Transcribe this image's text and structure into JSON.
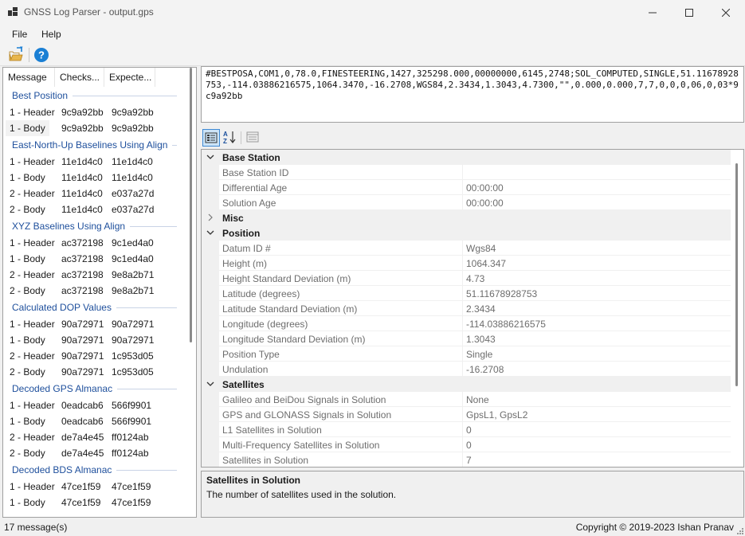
{
  "window": {
    "title": "GNSS Log Parser - output.gps"
  },
  "menu": {
    "file": "File",
    "help": "Help"
  },
  "message_list": {
    "columns": [
      "Message",
      "Checks...",
      "Expecte..."
    ],
    "groups": [
      {
        "name": "Best Position",
        "rows": [
          {
            "msg": "1 - Header",
            "check": "9c9a92bb",
            "expected": "9c9a92bb"
          },
          {
            "msg": "1 - Body",
            "check": "9c9a92bb",
            "expected": "9c9a92bb",
            "selected": true
          }
        ]
      },
      {
        "name": "East-North-Up Baselines Using Align",
        "rows": [
          {
            "msg": "1 - Header",
            "check": "11e1d4c0",
            "expected": "11e1d4c0"
          },
          {
            "msg": "1 - Body",
            "check": "11e1d4c0",
            "expected": "11e1d4c0"
          },
          {
            "msg": "2 - Header",
            "check": "11e1d4c0",
            "expected": "e037a27d"
          },
          {
            "msg": "2 - Body",
            "check": "11e1d4c0",
            "expected": "e037a27d"
          }
        ]
      },
      {
        "name": "XYZ Baselines Using Align",
        "rows": [
          {
            "msg": "1 - Header",
            "check": "ac372198",
            "expected": "9c1ed4a0"
          },
          {
            "msg": "1 - Body",
            "check": "ac372198",
            "expected": "9c1ed4a0"
          },
          {
            "msg": "2 - Header",
            "check": "ac372198",
            "expected": "9e8a2b71"
          },
          {
            "msg": "2 - Body",
            "check": "ac372198",
            "expected": "9e8a2b71"
          }
        ]
      },
      {
        "name": "Calculated DOP Values",
        "rows": [
          {
            "msg": "1 - Header",
            "check": "90a72971",
            "expected": "90a72971"
          },
          {
            "msg": "1 - Body",
            "check": "90a72971",
            "expected": "90a72971"
          },
          {
            "msg": "2 - Header",
            "check": "90a72971",
            "expected": "1c953d05"
          },
          {
            "msg": "2 - Body",
            "check": "90a72971",
            "expected": "1c953d05"
          }
        ]
      },
      {
        "name": "Decoded GPS Almanac",
        "rows": [
          {
            "msg": "1 - Header",
            "check": "0eadcab6",
            "expected": "566f9901"
          },
          {
            "msg": "1 - Body",
            "check": "0eadcab6",
            "expected": "566f9901"
          },
          {
            "msg": "2 - Header",
            "check": "de7a4e45",
            "expected": "ff0124ab"
          },
          {
            "msg": "2 - Body",
            "check": "de7a4e45",
            "expected": "ff0124ab"
          }
        ]
      },
      {
        "name": "Decoded BDS Almanac",
        "rows": [
          {
            "msg": "1 - Header",
            "check": "47ce1f59",
            "expected": "47ce1f59"
          },
          {
            "msg": "1 - Body",
            "check": "47ce1f59",
            "expected": "47ce1f59"
          }
        ]
      }
    ]
  },
  "raw_message": "#BESTPOSA,COM1,0,78.0,FINESTEERING,1427,325298.000,00000000,6145,2748;SOL_COMPUTED,SINGLE,51.11678928753,-114.03886216575,1064.3470,-16.2708,WGS84,2.3434,1.3043,4.7300,\"\",0.000,0.000,7,7,0,0,0,06,0,03*9c9a92bb",
  "property_grid": {
    "rows": [
      {
        "type": "category",
        "label": "Base Station",
        "expanded": true
      },
      {
        "type": "prop",
        "name": "Base Station ID",
        "value": ""
      },
      {
        "type": "prop",
        "name": "Differential Age",
        "value": "00:00:00"
      },
      {
        "type": "prop",
        "name": "Solution Age",
        "value": "00:00:00"
      },
      {
        "type": "category",
        "label": "Misc",
        "expanded": false
      },
      {
        "type": "category",
        "label": "Position",
        "expanded": true
      },
      {
        "type": "prop",
        "name": "Datum ID #",
        "value": "Wgs84"
      },
      {
        "type": "prop",
        "name": "Height (m)",
        "value": "1064.347"
      },
      {
        "type": "prop",
        "name": "Height Standard Deviation (m)",
        "value": "4.73"
      },
      {
        "type": "prop",
        "name": "Latitude (degrees)",
        "value": "51.11678928753"
      },
      {
        "type": "prop",
        "name": "Latitude Standard Deviation (m)",
        "value": "2.3434"
      },
      {
        "type": "prop",
        "name": "Longitude (degrees)",
        "value": "-114.03886216575"
      },
      {
        "type": "prop",
        "name": "Longitude Standard Deviation (m)",
        "value": "1.3043"
      },
      {
        "type": "prop",
        "name": "Position Type",
        "value": "Single"
      },
      {
        "type": "prop",
        "name": "Undulation",
        "value": "-16.2708"
      },
      {
        "type": "category",
        "label": "Satellites",
        "expanded": true
      },
      {
        "type": "prop",
        "name": "Galileo and BeiDou Signals in Solution",
        "value": "None"
      },
      {
        "type": "prop",
        "name": "GPS and GLONASS Signals in Solution",
        "value": "GpsL1, GpsL2"
      },
      {
        "type": "prop",
        "name": "L1 Satellites in Solution",
        "value": "0"
      },
      {
        "type": "prop",
        "name": "Multi-Frequency Satellites in Solution",
        "value": "0"
      },
      {
        "type": "prop",
        "name": "Satellites in Solution",
        "value": "7"
      }
    ]
  },
  "help": {
    "title": "Satellites in Solution",
    "description": "The number of satellites used in the solution."
  },
  "status": {
    "count": "17 message(s)",
    "copyright": "Copyright © 2019-2023 Ishan Pranav"
  },
  "icons": {
    "open": "open-folder-icon",
    "help": "help-icon",
    "categorized": "categorized-view-icon",
    "alphabetical": "alphabetical-sort-icon",
    "property_pages": "property-pages-icon"
  },
  "colors": {
    "group_header": "#1e4f9c",
    "help_icon": "#1a7fd4",
    "selected_toggle": "#cce4f7"
  }
}
